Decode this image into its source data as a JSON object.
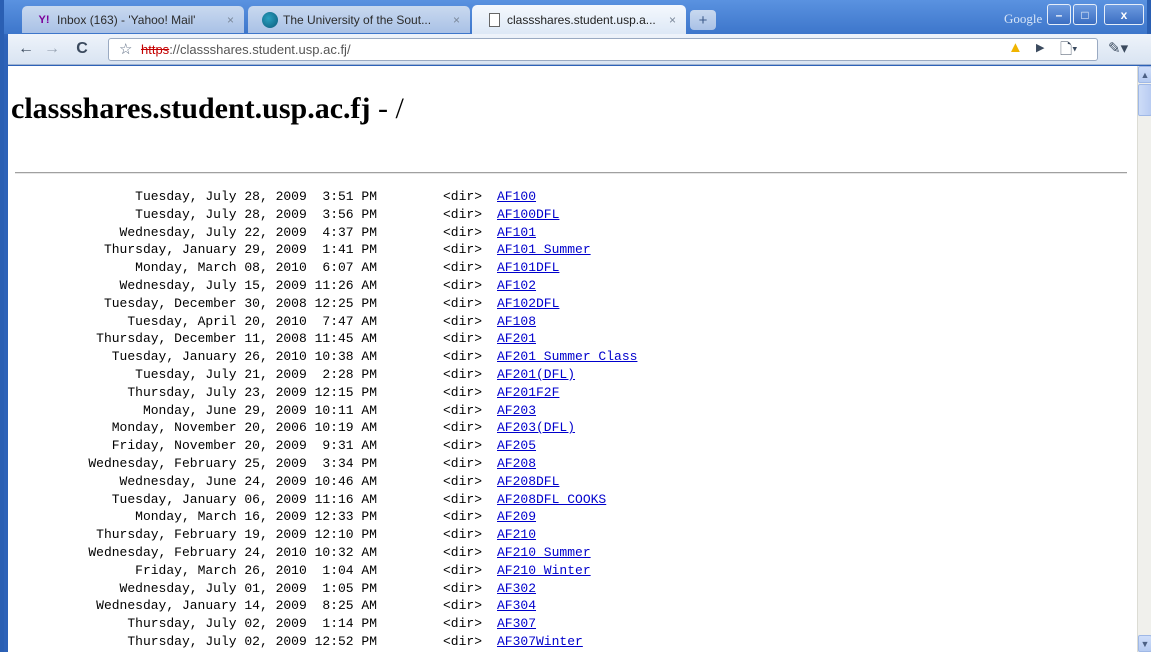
{
  "window": {
    "google_label": "Google",
    "minimize_label": "–",
    "maximize_label": "□",
    "close_label": "x"
  },
  "tabs": [
    {
      "title": "Inbox (163) - 'Yahoo! Mail'",
      "favicon_text": "Y!",
      "close": "×"
    },
    {
      "title": "The University of the Sout...",
      "close": "×"
    },
    {
      "title": "classshares.student.usp.a...",
      "close": "×"
    }
  ],
  "new_tab_label": "+",
  "toolbar": {
    "back": "←",
    "forward": "→",
    "reload": "C",
    "star": "☆",
    "url_scheme": "https",
    "url_rest": "://classshares.student.usp.ac.fj/",
    "warning": "▲",
    "go": "▶",
    "page_menu": "🗋▾",
    "wrench": "✎▾"
  },
  "page": {
    "host": "classshares.student.usp.ac.fj",
    "path_sep": " - /",
    "listing": [
      {
        "date": "Tuesday, July 28, 2009  3:51 PM",
        "type": "<dir>",
        "name": "AF100"
      },
      {
        "date": "Tuesday, July 28, 2009  3:56 PM",
        "type": "<dir>",
        "name": "AF100DFL"
      },
      {
        "date": "Wednesday, July 22, 2009  4:37 PM",
        "type": "<dir>",
        "name": "AF101"
      },
      {
        "date": "Thursday, January 29, 2009  1:41 PM",
        "type": "<dir>",
        "name": "AF101 Summer"
      },
      {
        "date": "Monday, March 08, 2010  6:07 AM",
        "type": "<dir>",
        "name": "AF101DFL"
      },
      {
        "date": "Wednesday, July 15, 2009 11:26 AM",
        "type": "<dir>",
        "name": "AF102"
      },
      {
        "date": "Tuesday, December 30, 2008 12:25 PM",
        "type": "<dir>",
        "name": "AF102DFL"
      },
      {
        "date": "Tuesday, April 20, 2010  7:47 AM",
        "type": "<dir>",
        "name": "AF108"
      },
      {
        "date": "Thursday, December 11, 2008 11:45 AM",
        "type": "<dir>",
        "name": "AF201"
      },
      {
        "date": "Tuesday, January 26, 2010 10:38 AM",
        "type": "<dir>",
        "name": "AF201 Summer Class"
      },
      {
        "date": "Tuesday, July 21, 2009  2:28 PM",
        "type": "<dir>",
        "name": "AF201(DFL)"
      },
      {
        "date": "Thursday, July 23, 2009 12:15 PM",
        "type": "<dir>",
        "name": "AF201F2F"
      },
      {
        "date": "Monday, June 29, 2009 10:11 AM",
        "type": "<dir>",
        "name": "AF203"
      },
      {
        "date": "Monday, November 20, 2006 10:19 AM",
        "type": "<dir>",
        "name": "AF203(DFL)"
      },
      {
        "date": "Friday, November 20, 2009  9:31 AM",
        "type": "<dir>",
        "name": "AF205"
      },
      {
        "date": "Wednesday, February 25, 2009  3:34 PM",
        "type": "<dir>",
        "name": "AF208"
      },
      {
        "date": "Wednesday, June 24, 2009 10:46 AM",
        "type": "<dir>",
        "name": "AF208DFL"
      },
      {
        "date": "Tuesday, January 06, 2009 11:16 AM",
        "type": "<dir>",
        "name": "AF208DFL_COOKS"
      },
      {
        "date": "Monday, March 16, 2009 12:33 PM",
        "type": "<dir>",
        "name": "AF209"
      },
      {
        "date": "Thursday, February 19, 2009 12:10 PM",
        "type": "<dir>",
        "name": "AF210"
      },
      {
        "date": "Wednesday, February 24, 2010 10:32 AM",
        "type": "<dir>",
        "name": "AF210 Summer"
      },
      {
        "date": "Friday, March 26, 2010  1:04 AM",
        "type": "<dir>",
        "name": "AF210 Winter"
      },
      {
        "date": "Wednesday, July 01, 2009  1:05 PM",
        "type": "<dir>",
        "name": "AF302"
      },
      {
        "date": "Wednesday, January 14, 2009  8:25 AM",
        "type": "<dir>",
        "name": "AF304"
      },
      {
        "date": "Thursday, July 02, 2009  1:14 PM",
        "type": "<dir>",
        "name": "AF307"
      },
      {
        "date": "Thursday, July 02, 2009 12:52 PM",
        "type": "<dir>",
        "name": "AF307Winter"
      }
    ]
  },
  "scrollbar": {
    "up": "▲",
    "down": "▼"
  }
}
